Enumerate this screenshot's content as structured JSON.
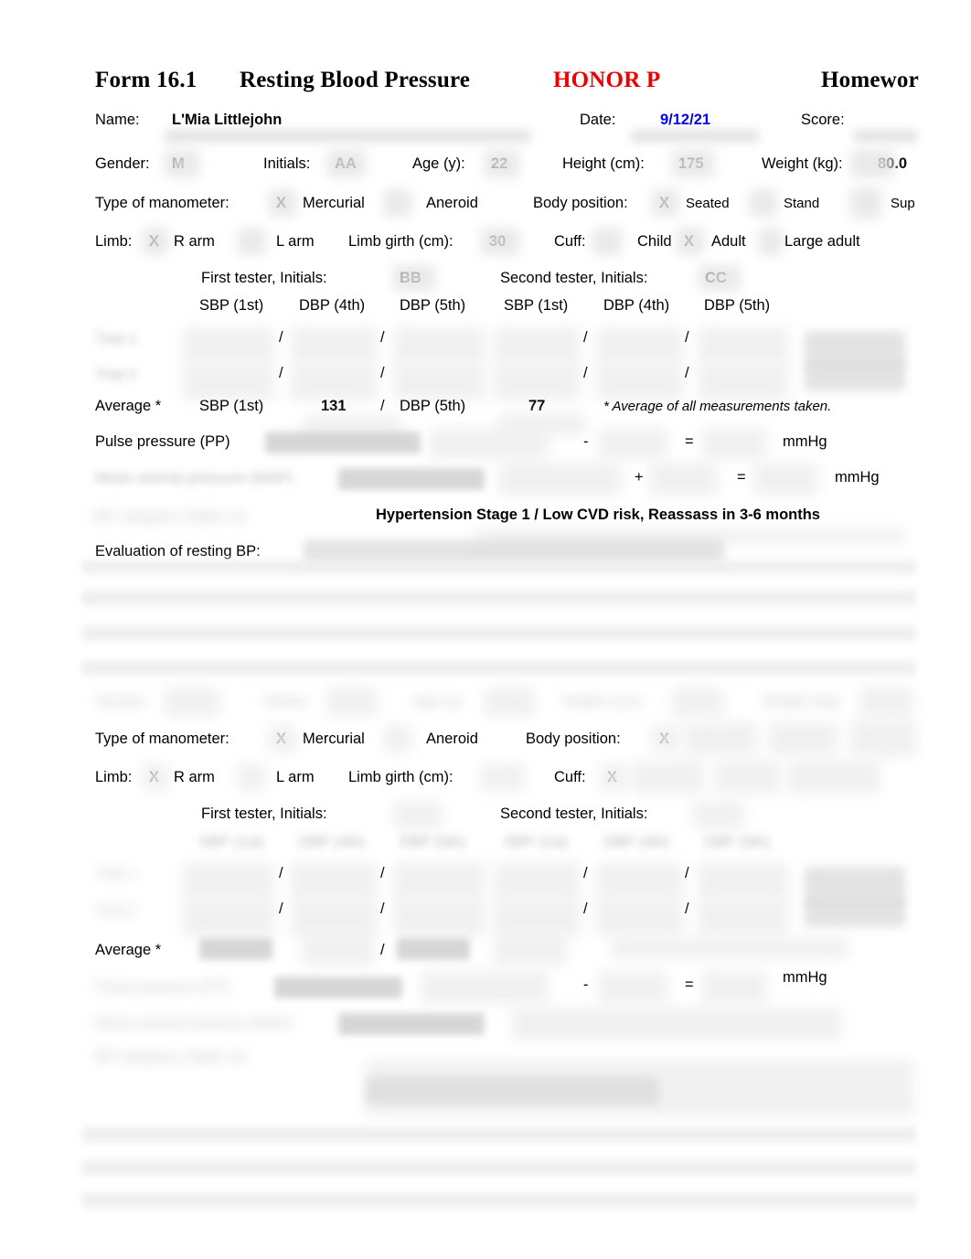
{
  "document": {
    "form_number": "Form 16.1",
    "form_title": "Resting Blood Pressure",
    "honor_label": "HONOR P",
    "homework_label": "Homewor",
    "colors": {
      "honor_red": "#ee0000",
      "date_blue": "#0000ee",
      "text_black": "#000000"
    }
  },
  "identity": {
    "name_label": "Name:",
    "name_value": "L'Mia Littlejohn",
    "date_label": "Date:",
    "date_value": "9/12/21",
    "score_label": "Score:",
    "score_value": ""
  },
  "demographics": {
    "gender_label": "Gender:",
    "gender_value": "M",
    "initials_label": "Initials:",
    "initials_value": "AA",
    "age_label": "Age (y):",
    "age_value": "22",
    "height_label": "Height (cm):",
    "height_value": "175",
    "weight_label": "Weight (kg):",
    "weight_value": "80.0"
  },
  "section1": {
    "manometer": {
      "label": "Type of manometer:",
      "mark": "X",
      "option_mercurial": "Mercurial",
      "option_aneroid": "Aneroid"
    },
    "body_position": {
      "label": "Body position:",
      "mark": "X",
      "option_seated": "Seated",
      "option_stand": "Stand",
      "option_sup": "Sup"
    },
    "limb": {
      "label": "Limb:",
      "mark": "X",
      "option_r_arm": "R arm",
      "option_l_arm": "L arm",
      "girth_label": "Limb girth (cm):",
      "girth_value": "30"
    },
    "cuff": {
      "label": "Cuff:",
      "mark": "X",
      "option_child": "Child",
      "option_adult": "Adult",
      "option_large_adult": "Large adult"
    },
    "testers": {
      "first_label": "First tester, Initials:",
      "first_value": "BB",
      "second_label": "Second tester, Initials:",
      "second_value": "CC"
    },
    "columns": [
      "SBP (1st)",
      "DBP (4th)",
      "DBP (5th)",
      "SBP (1st)",
      "DBP (4th)",
      "DBP (5th)"
    ],
    "trial_rows": [
      {
        "label": "Trial 1",
        "separators": [
          "/",
          "/",
          "/",
          "/"
        ]
      },
      {
        "label": "Trial 2",
        "separators": [
          "/",
          "/",
          "/",
          "/"
        ]
      }
    ],
    "average": {
      "label": "Average *",
      "sbp_label": "SBP (1st)",
      "sbp_value": "131",
      "separator": "/",
      "dbp_label": "DBP (5th)",
      "dbp_value": "77",
      "footnote": "* Average of all measurements taken."
    },
    "pulse_pressure": {
      "label": "Pulse pressure (PP)",
      "minus": "-",
      "equals": "=",
      "unit": "mmHg"
    },
    "mean_arterial": {
      "plus": "+",
      "equals": "=",
      "unit": "mmHg"
    },
    "classification": "Hypertension Stage 1   /   Low CVD risk, Reassass in 3-6 months",
    "evaluation": {
      "label": "Evaluation of resting BP:",
      "value": ""
    }
  },
  "section2": {
    "manometer": {
      "label": "Type of manometer:",
      "mark": "X",
      "option_mercurial": "Mercurial",
      "option_aneroid": "Aneroid"
    },
    "body_position": {
      "label": "Body position:",
      "mark": "X"
    },
    "limb": {
      "label": "Limb:",
      "mark": "X",
      "option_r_arm": "R arm",
      "option_l_arm": "L arm",
      "girth_label": "Limb girth (cm):"
    },
    "cuff": {
      "label": "Cuff:",
      "mark": "X"
    },
    "testers": {
      "first_label": "First tester, Initials:",
      "second_label": "Second tester, Initials:"
    },
    "trial_rows": [
      {
        "separators": [
          "/",
          "/",
          "/",
          "/"
        ]
      },
      {
        "separators": [
          "/",
          "/",
          "/",
          "/"
        ]
      }
    ],
    "average": {
      "label": "Average *",
      "separator": "/"
    },
    "pulse_pressure": {
      "minus": "-",
      "equals": "=",
      "unit": "mmHg"
    }
  }
}
